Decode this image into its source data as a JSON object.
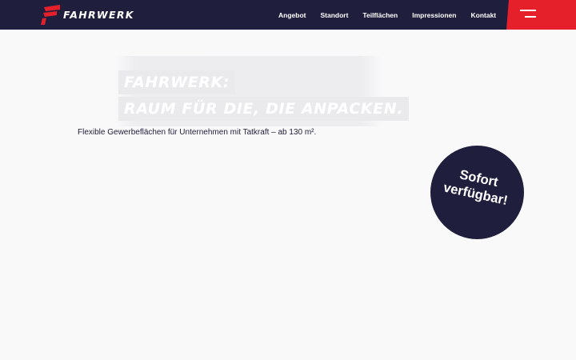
{
  "brand": {
    "name": "FAHRWERK",
    "colors": {
      "navy": "#1f1f3d",
      "red": "#e5202a",
      "background": "#f9f9fa"
    }
  },
  "nav": {
    "items": [
      {
        "label": "Angebot"
      },
      {
        "label": "Standort"
      },
      {
        "label": "Teilflächen"
      },
      {
        "label": "Impressionen"
      },
      {
        "label": "Kontakt"
      }
    ],
    "menu_icon": "hamburger-icon"
  },
  "hero": {
    "headline_line1": "FAHRWERK:",
    "headline_line2": "RAUM FÜR DIE, DIE ANPACKEN.",
    "subline": "Flexible Gewerbeflächen für Unternehmen mit Tatkraft – ab 130 m²."
  },
  "badge": {
    "line1": "Sofort",
    "line2": "verfügbar!"
  }
}
